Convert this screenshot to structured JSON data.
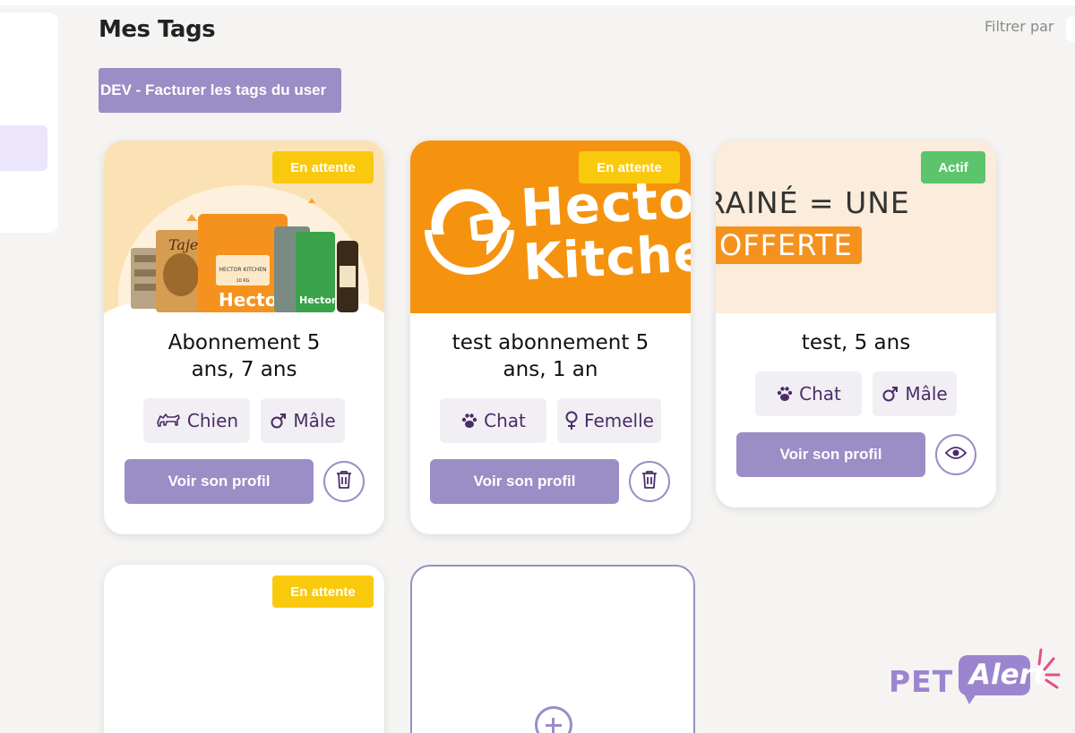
{
  "page": {
    "title": "Mes Tags",
    "filter_label": "Filtrer par"
  },
  "actions": {
    "dev_button": "DEV - Facturer les tags du user"
  },
  "cards": [
    {
      "status": "En attente",
      "title_line1": "Abonnement 5",
      "title_line2": "ans, 7 ans",
      "species": "Chien",
      "species_icon": "dog-icon",
      "sex": "Mâle",
      "sex_icon": "male-icon",
      "cta": "Voir son profil",
      "secondary_icon": "trash-icon"
    },
    {
      "status": "En attente",
      "title_line1": "test abonnement 5",
      "title_line2": "ans, 1 an",
      "species": "Chat",
      "species_icon": "paw-icon",
      "sex": "Femelle",
      "sex_icon": "female-icon",
      "cta": "Voir son profil",
      "secondary_icon": "trash-icon",
      "banner_text_1": "Hector",
      "banner_text_2": "Kitchen"
    },
    {
      "status": "Actif",
      "title_line1": "test, 5 ans",
      "species": "Chat",
      "species_icon": "paw-icon",
      "sex": "Mâle",
      "sex_icon": "male-icon",
      "cta": "Voir son profil",
      "secondary_icon": "eye-icon",
      "banner_text_1": "RAINÉ = UNE",
      "banner_text_2": "OFFERTE"
    },
    {
      "status": "En attente"
    }
  ],
  "add_card": {
    "icon": "plus-circle-icon"
  },
  "logo": {
    "part1": "PET",
    "part2": "Alert"
  },
  "colors": {
    "primary": "#9b8dc5",
    "pending": "#f9c90e",
    "active": "#5cc46a",
    "hector_orange": "#f5930f",
    "chip_bg": "#f1eff4",
    "chip_text": "#4a2c67"
  }
}
